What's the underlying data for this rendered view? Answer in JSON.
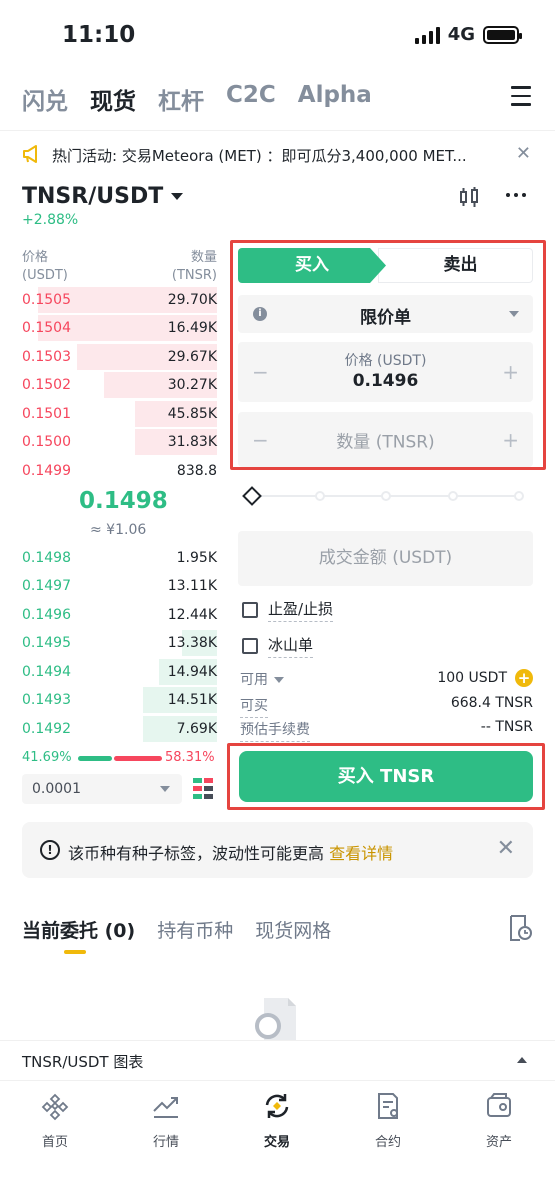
{
  "status_bar": {
    "time": "11:10",
    "network": "4G"
  },
  "top_tabs": [
    "闪兑",
    "现货",
    "杠杆",
    "C2C",
    "Alpha"
  ],
  "top_tab_active": 1,
  "announcement": {
    "text": "热门活动: 交易Meteora (MET) ：即可瓜分3,400,000 MET..."
  },
  "pair": {
    "symbol": "TNSR/USDT",
    "change": "+2.88%"
  },
  "orderbook": {
    "price_header": "价格",
    "price_unit": "(USDT)",
    "qty_header": "数量",
    "qty_unit": "(TNSR)",
    "asks": [
      {
        "price": "0.1505",
        "qty": "29.70K",
        "depth": 0.92
      },
      {
        "price": "0.1504",
        "qty": "16.49K",
        "depth": 0.92
      },
      {
        "price": "0.1503",
        "qty": "29.67K",
        "depth": 0.72
      },
      {
        "price": "0.1502",
        "qty": "30.27K",
        "depth": 0.58
      },
      {
        "price": "0.1501",
        "qty": "45.85K",
        "depth": 0.42
      },
      {
        "price": "0.1500",
        "qty": "31.83K",
        "depth": 0.42
      },
      {
        "price": "0.1499",
        "qty": "838.8",
        "depth": 0.0
      }
    ],
    "last_price": "0.1498",
    "last_price_cny": "≈ ¥1.06",
    "bids": [
      {
        "price": "0.1498",
        "qty": "1.95K",
        "depth": 0.0
      },
      {
        "price": "0.1497",
        "qty": "13.11K",
        "depth": 0.0
      },
      {
        "price": "0.1496",
        "qty": "12.44K",
        "depth": 0.0
      },
      {
        "price": "0.1495",
        "qty": "13.38K",
        "depth": 0.18
      },
      {
        "price": "0.1494",
        "qty": "14.94K",
        "depth": 0.3
      },
      {
        "price": "0.1493",
        "qty": "14.51K",
        "depth": 0.38
      },
      {
        "price": "0.1492",
        "qty": "7.69K",
        "depth": 0.38
      }
    ],
    "buy_ratio": "41.69%",
    "sell_ratio": "58.31%",
    "precision": "0.0001"
  },
  "order_form": {
    "buy_label": "买入",
    "sell_label": "卖出",
    "order_type": "限价单",
    "price_label": "价格 (USDT)",
    "price_value": "0.1496",
    "qty_placeholder": "数量 (TNSR)",
    "total_placeholder": "成交金额 (USDT)",
    "tpsl_label": "止盈/止损",
    "iceberg_label": "冰山单",
    "available_label": "可用",
    "available_value": "100 USDT",
    "can_buy_label": "可买",
    "can_buy_value": "668.4 TNSR",
    "fee_label": "预估手续费",
    "fee_value": "-- TNSR",
    "buy_button": "买入 TNSR"
  },
  "warning": {
    "text": "该币种有种子标签，波动性可能更高",
    "link": "查看详情"
  },
  "bottom_tabs": [
    "当前委托 (0)",
    "持有币种",
    "现货网格"
  ],
  "chart_bar_label": "TNSR/USDT 图表",
  "nav": [
    {
      "label": "首页",
      "icon": "home-icon"
    },
    {
      "label": "行情",
      "icon": "markets-icon"
    },
    {
      "label": "交易",
      "icon": "trade-icon"
    },
    {
      "label": "合约",
      "icon": "futures-icon"
    },
    {
      "label": "资产",
      "icon": "wallet-icon"
    }
  ],
  "colors": {
    "buy": "#2ebd85",
    "sell": "#f6465d",
    "accent": "#f0b90b",
    "highlight": "#e5443f"
  }
}
